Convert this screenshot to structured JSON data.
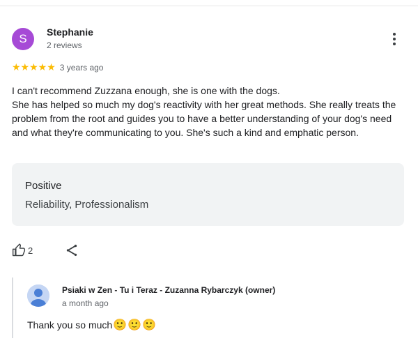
{
  "review": {
    "reviewer": {
      "initial": "S",
      "name": "Stephanie",
      "meta": "2 reviews",
      "avatar_color": "#a64ad6"
    },
    "rating": {
      "stars_text": "★★★★★",
      "stars": 5,
      "date": "3 years ago"
    },
    "text_lines": [
      "I can't recommend Zuzzana enough, she is one with the dogs.",
      "She has helped so much my dog's reactivity with her great methods. She really treats the problem from the root and guides you to have a better understanding of your dog's need and what they're communicating to you. She's such a kind and emphatic person."
    ],
    "highlight": {
      "title": "Positive",
      "value": "Reliability, Professionalism"
    },
    "actions": {
      "like_count": "2",
      "like_icon": "thumbs-up-icon",
      "share_icon": "share-icon"
    },
    "reply": {
      "owner_name": "Psiaki w Zen - Tu i Teraz - Zuzanna Rybarczyk (owner)",
      "date": "a month ago",
      "text": "Thank you so much",
      "emojis": "🙂🙂🙂"
    }
  }
}
